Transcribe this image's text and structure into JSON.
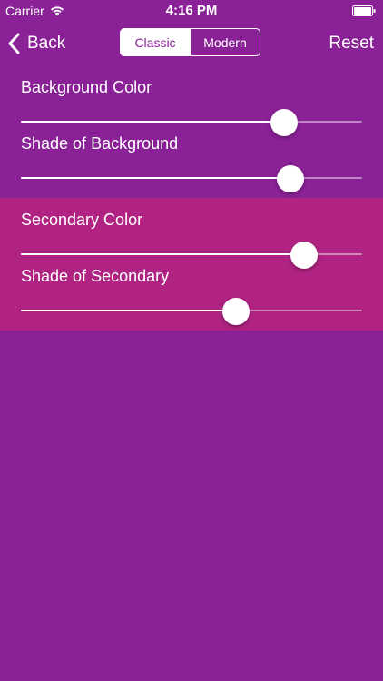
{
  "status_bar": {
    "carrier": "Carrier",
    "time": "4:16 PM"
  },
  "nav": {
    "back_label": "Back",
    "segments": [
      "Classic",
      "Modern"
    ],
    "selected_segment": "Classic",
    "reset_label": "Reset"
  },
  "sliders": [
    {
      "label": "Background Color",
      "value": 0.77
    },
    {
      "label": "Shade of Background",
      "value": 0.79
    },
    {
      "label": "Secondary Color",
      "value": 0.83
    },
    {
      "label": "Shade of Secondary",
      "value": 0.63
    }
  ],
  "colors": {
    "background": "#8a2197",
    "secondary": "#b02382",
    "foreground": "#ffffff"
  }
}
